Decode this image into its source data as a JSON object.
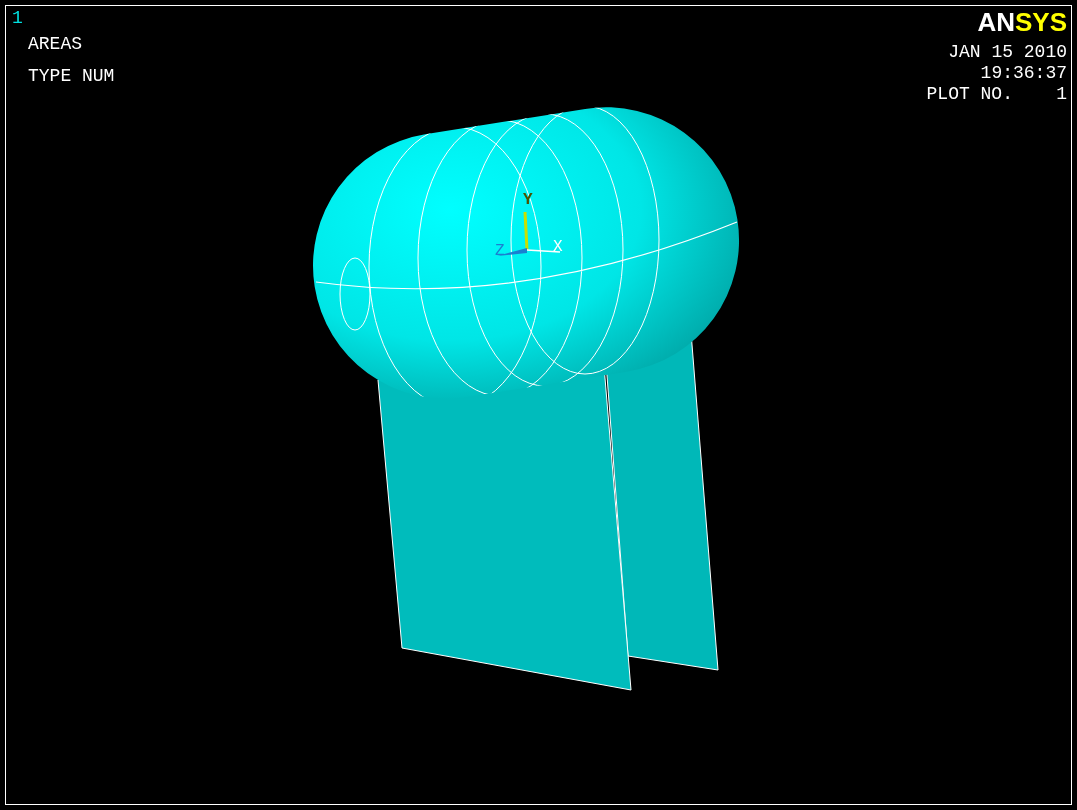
{
  "window_number": "1",
  "plot_info": {
    "entity": "AREAS",
    "label_type": "TYPE NUM"
  },
  "logo": {
    "parts": [
      {
        "text": "AN",
        "color": "#ffffff"
      },
      {
        "text": "SYS",
        "color": "#ffff00"
      }
    ]
  },
  "stamp": {
    "date": "JAN 15 2010",
    "time": "19:36:37",
    "plot_no": "PLOT NO.    1"
  },
  "triad": {
    "x": "X",
    "y": "Y",
    "z": "Z"
  }
}
